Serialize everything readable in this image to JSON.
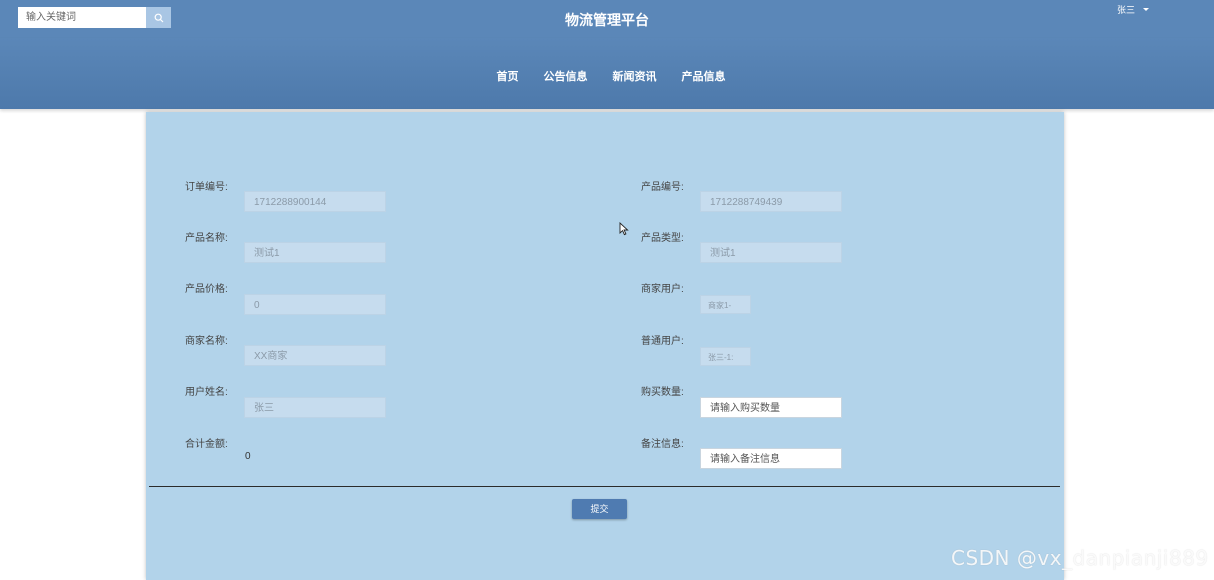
{
  "header": {
    "search_placeholder": "输入关键词",
    "title": "物流管理平台",
    "user_name": "张三"
  },
  "nav": {
    "items": [
      "首页",
      "公告信息",
      "新闻资讯",
      "产品信息"
    ]
  },
  "form": {
    "order_no_label": "订单编号:",
    "order_no_value": "1712288900144",
    "product_no_label": "产品编号:",
    "product_no_value": "1712288749439",
    "product_name_label": "产品名称:",
    "product_name_value": "测试1",
    "product_type_label": "产品类型:",
    "product_type_value": "测试1",
    "product_price_label": "产品价格:",
    "product_price_value": "0",
    "merchant_user_label": "商家用户:",
    "merchant_user_value": "商家1-",
    "merchant_name_label": "商家名称:",
    "merchant_name_value": "XX商家",
    "normal_user_label": "普通用户:",
    "normal_user_value": "张三-1:",
    "user_name_label": "用户姓名:",
    "user_name_value": "张三",
    "quantity_label": "购买数量:",
    "quantity_placeholder": "请输入购买数量",
    "total_label": "合计金额:",
    "total_value": "0",
    "remark_label": "备注信息:",
    "remark_placeholder": "请输入备注信息",
    "submit_label": "提交"
  },
  "watermark": "CSDN @vx_danpianji889",
  "colors": {
    "header_bg": "#5b87b8",
    "panel_bg": "#b2d3ea",
    "button_bg": "#4f7bb1"
  }
}
